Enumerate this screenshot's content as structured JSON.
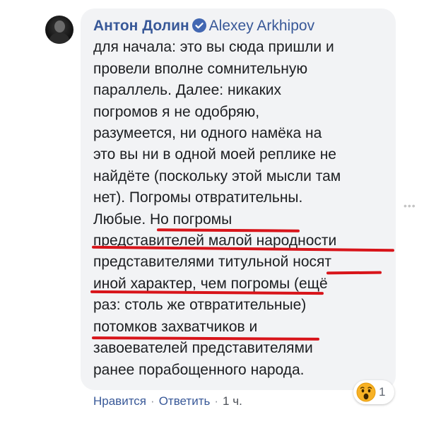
{
  "comment": {
    "author": "Антон Долин",
    "reply_to": "Alexey Arkhipov",
    "lines": [
      "для начала: это вы сюда пришли и",
      "провели вполне сомнительную",
      "параллель. Далее: никаких",
      "погромов я не одобряю,",
      "разумеется, ни одного намёка на",
      "это вы ни в одной моей реплике не",
      "найдёте (поскольку этой мысли там",
      "нет). Погромы отвратительны.",
      "Любые. Но погромы",
      "представителей малой народности",
      "представителями титульной носят",
      "иной характер, чем погромы (ещё",
      "раз: столь же отвратительные)",
      "потомков захватчиков и",
      "завоевателей представителями",
      "ранее порабощенного народа."
    ],
    "highlight_color": "#d8141a"
  },
  "reaction": {
    "icon": "wow-emoji-icon",
    "count": "1"
  },
  "actions": {
    "like": "Нравится",
    "reply": "Ответить",
    "time": "1 ч.",
    "separator": "·"
  },
  "colors": {
    "bubble": "#f2f3f5",
    "link": "#385898",
    "text": "#1c1e21"
  }
}
